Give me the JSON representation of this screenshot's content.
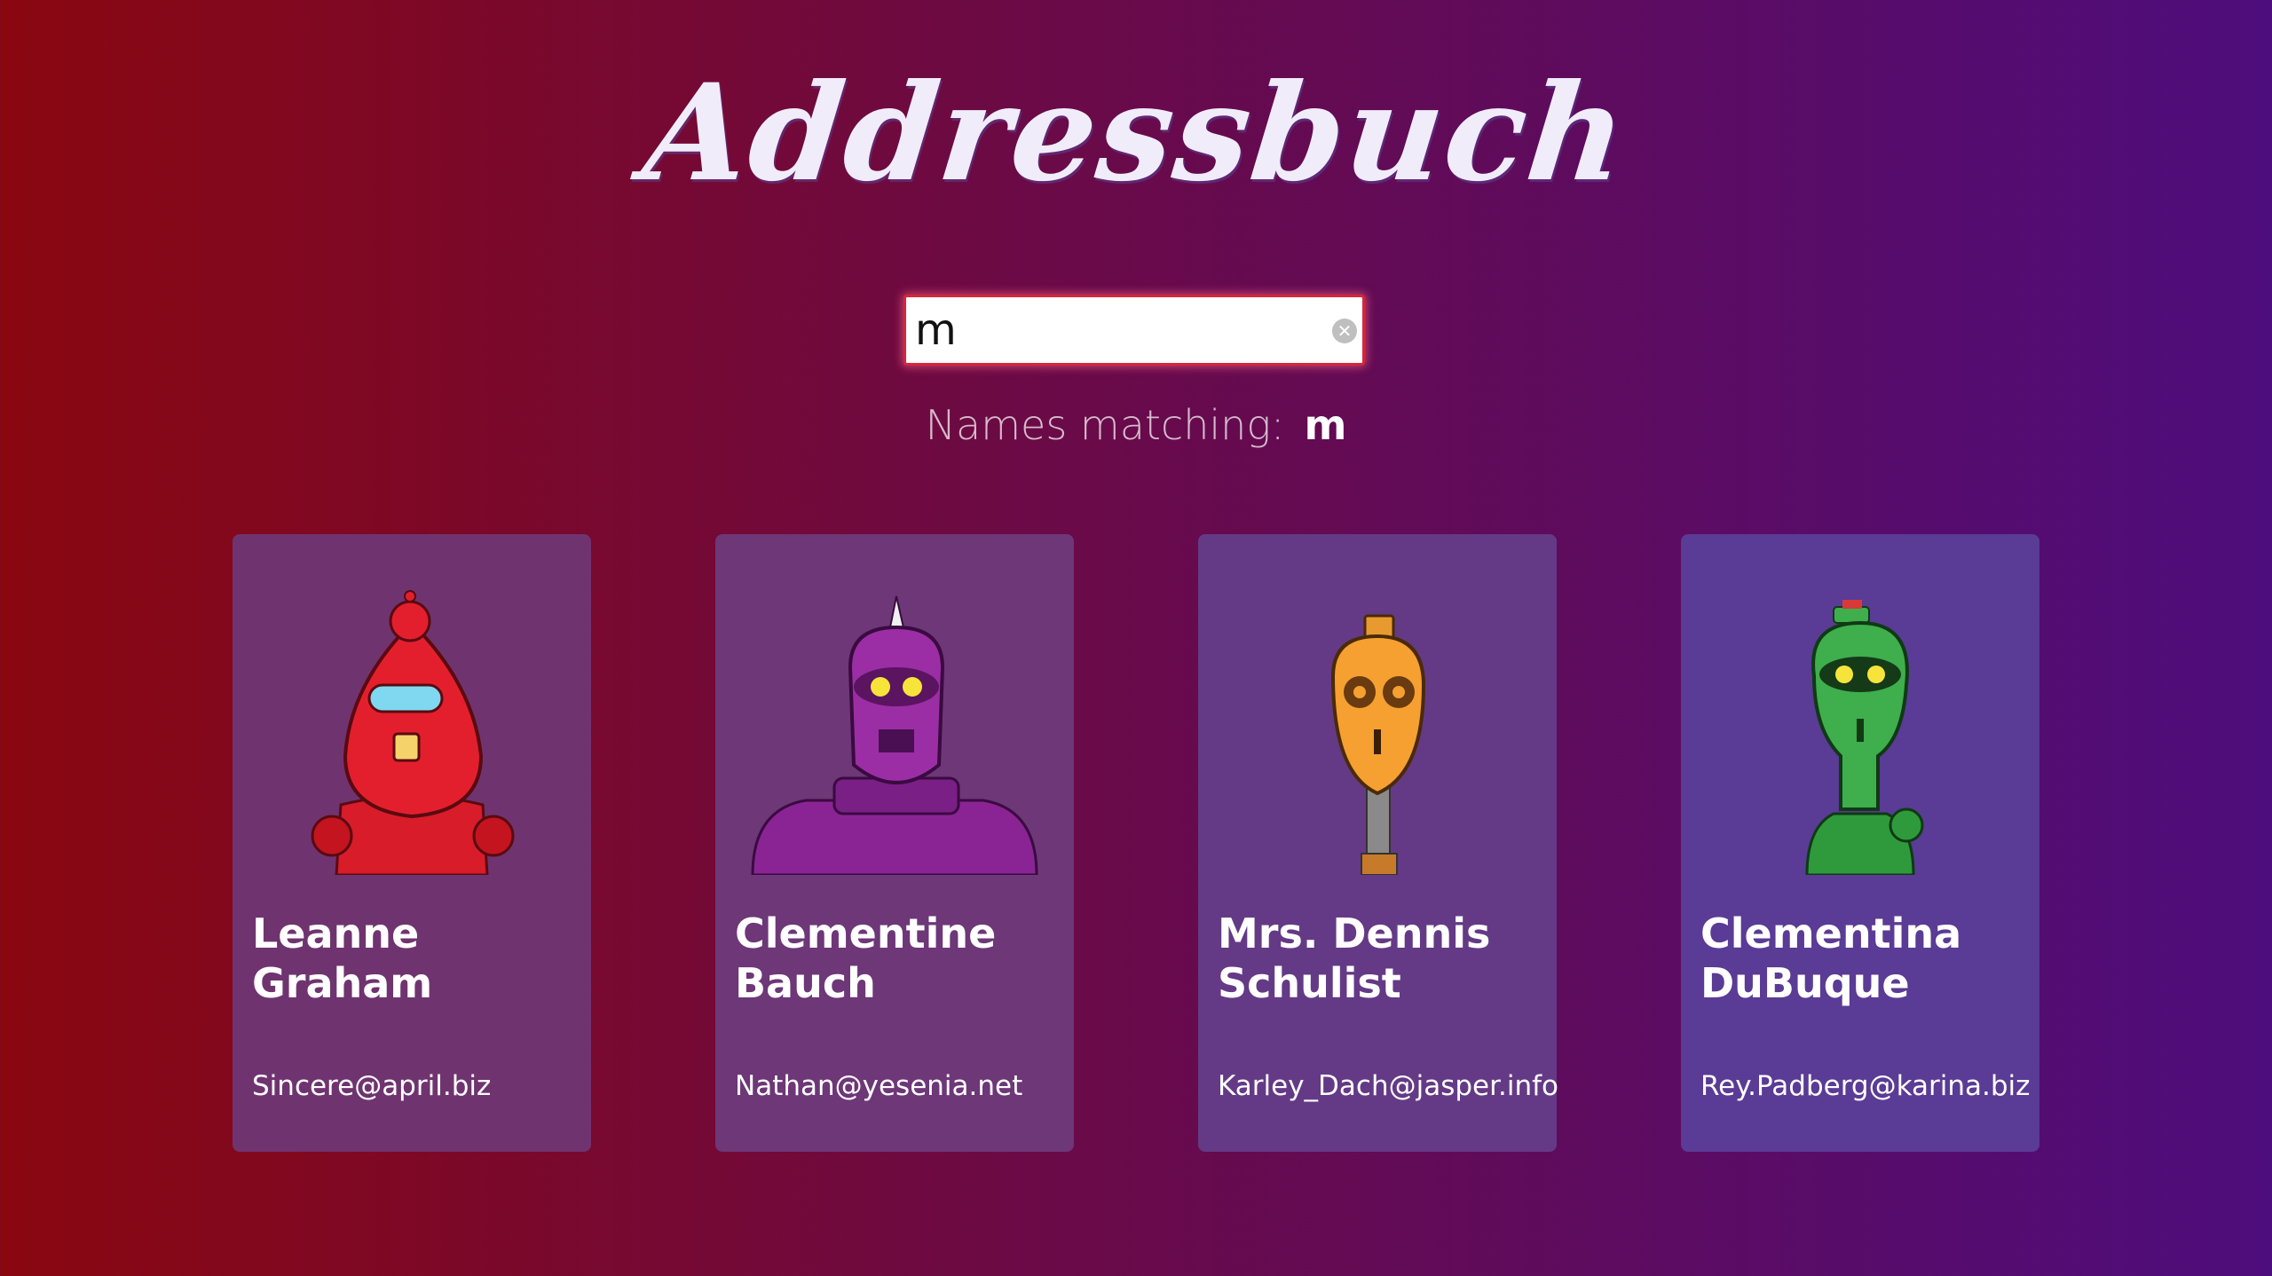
{
  "header": {
    "title": "Addressbuch"
  },
  "search": {
    "value": "m",
    "clear_icon": "clear-icon"
  },
  "filter": {
    "label": "Names matching:",
    "term": "m"
  },
  "cards": [
    {
      "name": "Leanne Graham",
      "email": "Sincere@april.biz",
      "robot_color": "#e41f2d"
    },
    {
      "name": "Clementine Bauch",
      "email": "Nathan@yesenia.net",
      "robot_color": "#9b2ea4"
    },
    {
      "name": "Mrs. Dennis Schulist",
      "email": "Karley_Dach@jasper.info",
      "robot_color": "#f5a030"
    },
    {
      "name": "Clementina DuBuque",
      "email": "Rey.Padberg@karina.biz",
      "robot_color": "#3fae4c"
    }
  ],
  "colors": {
    "bg_left": "#8a0710",
    "bg_right": "#4e0d7c",
    "search_border": "#d6253b"
  }
}
